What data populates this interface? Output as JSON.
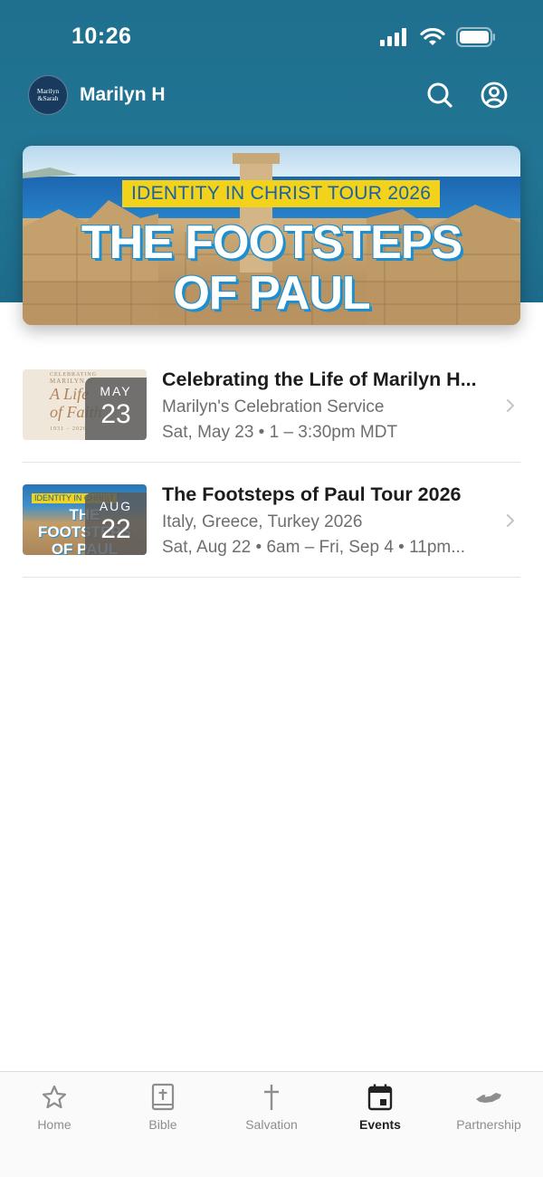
{
  "status_bar": {
    "time": "10:26"
  },
  "header": {
    "avatar_text_line1": "Marilyn",
    "avatar_text_line2": "&Sarah",
    "user_name": "Marilyn H"
  },
  "banner": {
    "ribbon": "IDENTITY IN CHRIST TOUR 2026",
    "title_line1": "THE FOOTSTEPS",
    "title_line2": "OF PAUL"
  },
  "events": [
    {
      "month": "MAY",
      "day": "23",
      "title": "Celebrating the Life of Marilyn H...",
      "subtitle": "Marilyn's Celebration Service",
      "date_text": "Sat, May 23 • 1 – 3:30pm MDT",
      "thumb_line1": "CELEBRATING",
      "thumb_line2": "MARILYN H",
      "thumb_line3": "A Life of Faith",
      "thumb_line4": "1931 – 2026"
    },
    {
      "month": "AUG",
      "day": "22",
      "title": "The Footsteps of Paul Tour 2026",
      "subtitle": "Italy, Greece, Turkey 2026",
      "date_text": "Sat, Aug 22 • 6am – Fri, Sep 4 • 11pm...",
      "thumb_line1": "IDENTITY IN CHRIST",
      "thumb_line2": "THE FOOTSTEPS",
      "thumb_line3": "OF PAUL"
    }
  ],
  "tabs": [
    {
      "label": "Home",
      "icon": "star-icon",
      "active": false
    },
    {
      "label": "Bible",
      "icon": "bible-icon",
      "active": false
    },
    {
      "label": "Salvation",
      "icon": "cross-icon",
      "active": false
    },
    {
      "label": "Events",
      "icon": "calendar-icon",
      "active": true
    },
    {
      "label": "Partnership",
      "icon": "handshake-icon",
      "active": false
    }
  ],
  "colors": {
    "header_blue": "#227594",
    "ribbon_yellow": "#f2d21a",
    "title_blue": "#1d8fd1"
  }
}
